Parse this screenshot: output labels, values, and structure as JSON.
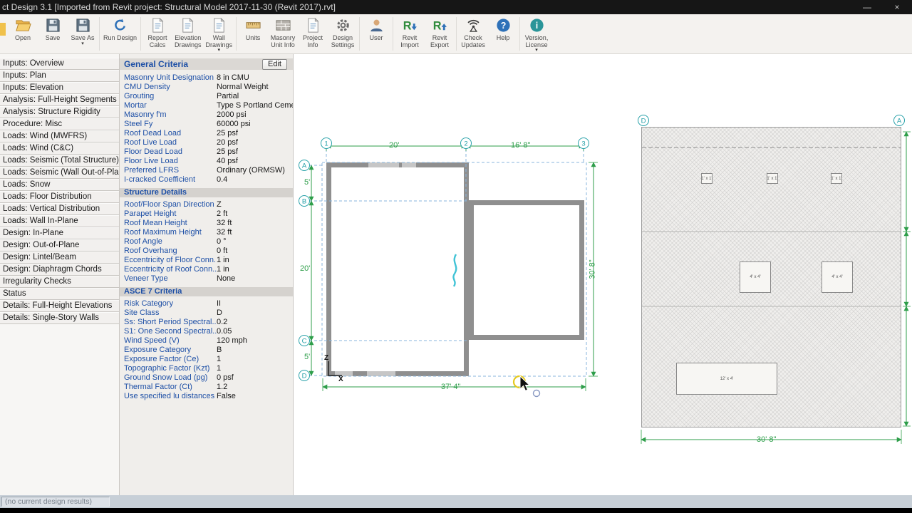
{
  "title_bar": {
    "title": "ct Design 3.1    [Imported from Revit project:  Structural Model 2017-11-30 (Revit 2017).rvt]",
    "minimize_glyph": "—",
    "close_glyph": "×"
  },
  "icon_glyphs": {
    "dropdown-arrow": "▾",
    "revit-letter": "R",
    "help-glyph": "?",
    "info-glyph": "i"
  },
  "toolbar": {
    "groups": [
      [
        {
          "label": "Open",
          "icon": "folder-open-icon"
        },
        {
          "label": "Save",
          "icon": "save-icon"
        },
        {
          "label": "Save As",
          "icon": "save-as-icon",
          "dropdown": true
        }
      ],
      [
        {
          "label": "Run Design",
          "icon": "run-design-icon"
        }
      ],
      [
        {
          "label": "Report\nCalcs",
          "icon": "report-calcs-icon"
        },
        {
          "label": "Elevation\nDrawings",
          "icon": "elevation-drawings-icon"
        },
        {
          "label": "Wall\nDrawings",
          "icon": "wall-drawings-icon",
          "dropdown": true
        }
      ],
      [
        {
          "label": "Units",
          "icon": "units-icon"
        },
        {
          "label": "Masonry\nUnit Info",
          "icon": "masonry-unit-info-icon"
        },
        {
          "label": "Project\nInfo",
          "icon": "project-info-icon"
        },
        {
          "label": "Design\nSettings",
          "icon": "design-settings-icon"
        }
      ],
      [
        {
          "label": "User",
          "icon": "user-icon"
        }
      ],
      [
        {
          "label": "Revit\nImport",
          "icon": "revit-import-icon"
        },
        {
          "label": "Revit\nExport",
          "icon": "revit-export-icon"
        }
      ],
      [
        {
          "label": "Check\nUpdates",
          "icon": "check-updates-icon"
        },
        {
          "label": "Help",
          "icon": "help-icon"
        }
      ],
      [
        {
          "label": "Version,\nLicense",
          "icon": "version-license-icon",
          "dropdown": true
        }
      ]
    ]
  },
  "sidebar": {
    "items": [
      "Inputs: Overview",
      "Inputs: Plan",
      "Inputs: Elevation",
      "Analysis: Full-Height Segments",
      "Analysis: Structure Rigidity",
      "Procedure: Misc",
      "Loads: Wind (MWFRS)",
      "Loads: Wind (C&C)",
      "Loads: Seismic (Total Structure)",
      "Loads: Seismic (Wall Out-of-Plane)",
      "Loads: Snow",
      "Loads: Floor Distribution",
      "Loads: Vertical Distribution",
      "Loads: Wall In-Plane",
      "Design: In-Plane",
      "Design: Out-of-Plane",
      "Design: Lintel/Beam",
      "Design: Diaphragm Chords",
      "Irregularity Checks",
      "Status",
      "Details: Full-Height Elevations",
      "Details: Single-Story Walls"
    ]
  },
  "properties": {
    "header_title": "General Criteria",
    "edit_label": "Edit",
    "groups": [
      {
        "rows": [
          [
            "Masonry Unit Designation",
            "8 in CMU"
          ],
          [
            "CMU Density",
            "Normal Weight"
          ],
          [
            "Grouting",
            "Partial"
          ],
          [
            "Mortar",
            "Type S Portland Cemen..."
          ],
          [
            "Masonry f'm",
            "2000 psi"
          ],
          [
            "Steel Fy",
            "60000 psi"
          ],
          [
            "Roof Dead Load",
            "25 psf"
          ],
          [
            "Roof Live Load",
            "20 psf"
          ],
          [
            "Floor Dead Load",
            "25 psf"
          ],
          [
            "Floor Live Load",
            "40 psf"
          ],
          [
            "Preferred LFRS",
            "Ordinary (ORMSW)"
          ],
          [
            "I-cracked Coefficient",
            "0.4"
          ]
        ]
      },
      {
        "title": "Structure Details",
        "rows": [
          [
            "Roof/Floor Span Direction",
            "Z"
          ],
          [
            "Parapet Height",
            "2 ft"
          ],
          [
            "Roof Mean Height",
            "32 ft"
          ],
          [
            "Roof Maximum Height",
            "32 ft"
          ],
          [
            "Roof Angle",
            "0 °"
          ],
          [
            "Roof Overhang",
            "0 ft"
          ],
          [
            "Eccentricity of Floor Conn...",
            "1 in"
          ],
          [
            "Eccentricity of Roof Conn...",
            "1 in"
          ],
          [
            "Veneer Type",
            "None"
          ]
        ]
      },
      {
        "title": "ASCE 7 Criteria",
        "rows": [
          [
            "Risk Category",
            "II"
          ],
          [
            "Site Class",
            "D"
          ],
          [
            "Ss: Short Period Spectral...",
            "0.2"
          ],
          [
            "S1: One Second Spectral...",
            "0.05"
          ],
          [
            "Wind Speed (V)",
            "120 mph"
          ],
          [
            "Exposure Category",
            "B"
          ],
          [
            "Exposure Factor (Ce)",
            "1"
          ],
          [
            "Topographic Factor (Kzt)",
            "1"
          ],
          [
            "Ground Snow Load (pg)",
            "0 psf"
          ],
          [
            "Thermal Factor (Ct)",
            "1.2"
          ],
          [
            "Use specified lu distances",
            "False"
          ]
        ]
      }
    ]
  },
  "plan": {
    "grid_top": [
      "1",
      "2",
      "3"
    ],
    "grid_left": [
      "A",
      "B",
      "C",
      "D"
    ],
    "dim_top": [
      "20'",
      "16' 8\""
    ],
    "dim_left": [
      "5'",
      "20'",
      "5'"
    ],
    "dim_bottom": "37' 4\"",
    "dim_right": "30' 8\"",
    "axis_z": "Z",
    "axis_x": "X"
  },
  "elevation": {
    "grid": [
      "D",
      "A"
    ],
    "openings": [
      "1' x 1'",
      "1' x 1'",
      "1' x 1'",
      "4' x 4'",
      "4' x 4'",
      "12' x 4'"
    ],
    "dim_bottom": "30' 8\""
  },
  "status_bar": {
    "message": "(no current design results)"
  }
}
